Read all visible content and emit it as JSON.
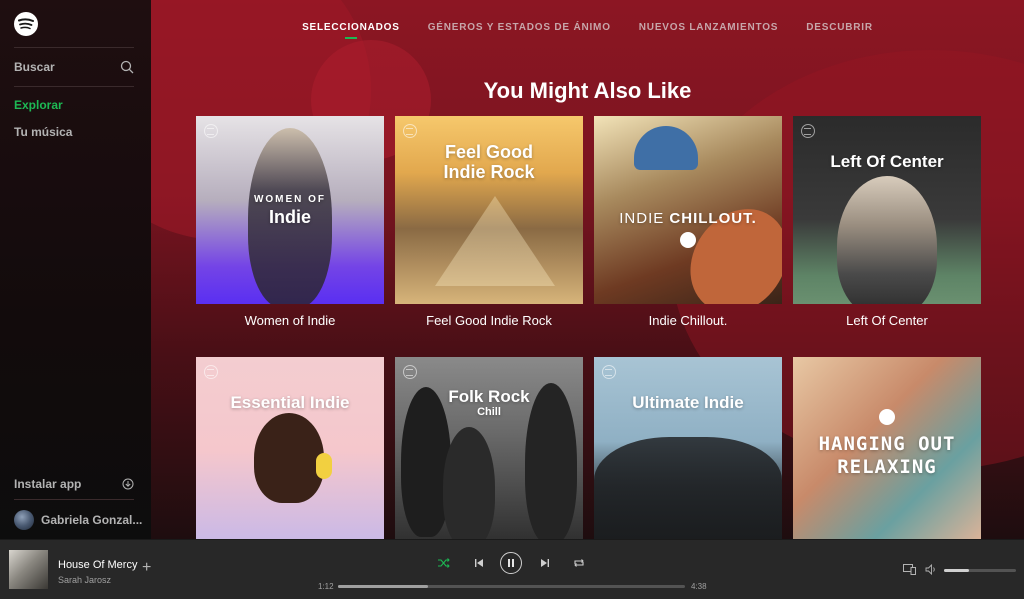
{
  "sidebar": {
    "search_label": "Buscar",
    "nav": [
      {
        "label": "Explorar",
        "active": true
      },
      {
        "label": "Tu música",
        "active": false
      }
    ],
    "install_label": "Instalar app",
    "user_name": "Gabriela Gonzal..."
  },
  "top_nav": {
    "tabs": [
      {
        "label": "SELECCIONADOS",
        "active": true
      },
      {
        "label": "GÉNEROS Y ESTADOS DE ÁNIMO",
        "active": false
      },
      {
        "label": "NUEVOS LANZAMIENTOS",
        "active": false
      },
      {
        "label": "DESCUBRIR",
        "active": false
      }
    ]
  },
  "section_title": "You Might Also Like",
  "playlists": [
    {
      "title": "Women of Indie",
      "cover_line1": "WOMEN OF",
      "cover_line2": "Indie"
    },
    {
      "title": "Feel Good Indie Rock",
      "cover_line1": "Feel Good",
      "cover_line2": "Indie Rock"
    },
    {
      "title": "Indie Chillout.",
      "cover_line1": "INDIE",
      "cover_line2": "CHILLOUT."
    },
    {
      "title": "Left Of Center",
      "cover_line1": "Left Of Center",
      "cover_line2": ""
    },
    {
      "title": "",
      "cover_line1": "Essential Indie",
      "cover_line2": ""
    },
    {
      "title": "",
      "cover_line1": "Folk Rock",
      "cover_line2": "Chill"
    },
    {
      "title": "",
      "cover_line1": "Ultimate Indie",
      "cover_line2": ""
    },
    {
      "title": "",
      "cover_line1": "HANGING OUT",
      "cover_line2": "RELAXING"
    }
  ],
  "now_playing": {
    "title": "House Of Mercy",
    "artist": "Sarah Jarosz",
    "add_symbol": "+",
    "elapsed": "1:12",
    "duration": "4:38",
    "progress": 0.26,
    "volume": 0.35
  },
  "colors": {
    "accent": "#1db954",
    "main_bg_top": "#8c1623",
    "player_bg": "#282828"
  },
  "icons": [
    "spotify-logo-icon",
    "search-icon",
    "download-icon",
    "shuffle-icon",
    "previous-icon",
    "pause-icon",
    "next-icon",
    "repeat-icon",
    "devices-icon",
    "volume-icon"
  ]
}
